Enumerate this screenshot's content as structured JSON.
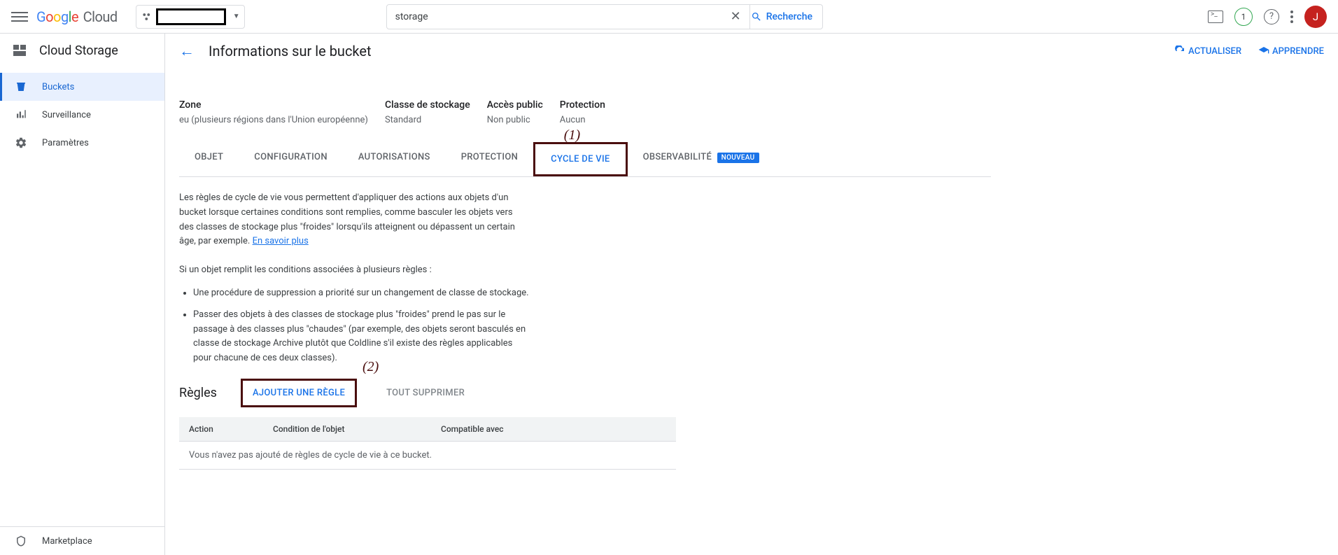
{
  "topbar": {
    "search_value": "storage",
    "search_button": "Recherche",
    "badge_count": "1",
    "avatar_letter": "J"
  },
  "sidebar": {
    "product": "Cloud Storage",
    "items": [
      {
        "label": "Buckets"
      },
      {
        "label": "Surveillance"
      },
      {
        "label": "Paramètres"
      }
    ],
    "footer": {
      "label": "Marketplace"
    }
  },
  "page": {
    "title": "Informations sur le bucket",
    "refresh": "ACTUALISER",
    "learn": "APPRENDRE"
  },
  "info": {
    "zone_label": "Zone",
    "zone_value": "eu (plusieurs régions dans l'Union européenne)",
    "class_label": "Classe de stockage",
    "class_value": "Standard",
    "access_label": "Accès public",
    "access_value": "Non public",
    "protection_label": "Protection",
    "protection_value": "Aucun"
  },
  "annotations": {
    "one": "(1)",
    "two": "(2)"
  },
  "tabs": {
    "objet": "OBJET",
    "config": "CONFIGURATION",
    "auth": "AUTORISATIONS",
    "protection": "PROTECTION",
    "lifecycle": "CYCLE DE VIE",
    "observ": "OBSERVABILITÉ",
    "new_badge": "NOUVEAU"
  },
  "lifecycle": {
    "desc": "Les règles de cycle de vie vous permettent d'appliquer des actions aux objets d'un bucket lorsque certaines conditions sont remplies, comme basculer les objets vers des classes de stockage plus \"froides\" lorsqu'ils atteignent ou dépassent un certain âge, par exemple.",
    "learn_more": "En savoir plus",
    "multi_intro": "Si un objet remplit les conditions associées à plusieurs règles :",
    "rule1": "Une procédure de suppression a priorité sur un changement de classe de stockage.",
    "rule2": "Passer des objets à des classes de stockage plus \"froides\" prend le pas sur le passage à des classes plus \"chaudes\" (par exemple, des objets seront basculés en classe de stockage Archive plutôt que Coldline s'il existe des règles applicables pour chacune de ces deux classes).",
    "rules_heading": "Règles",
    "add_rule": "AJOUTER UNE RÈGLE",
    "delete_all": "TOUT SUPPRIMER",
    "col_action": "Action",
    "col_condition": "Condition de l'objet",
    "col_compat": "Compatible avec",
    "empty": "Vous n'avez pas ajouté de règles de cycle de vie à ce bucket."
  }
}
